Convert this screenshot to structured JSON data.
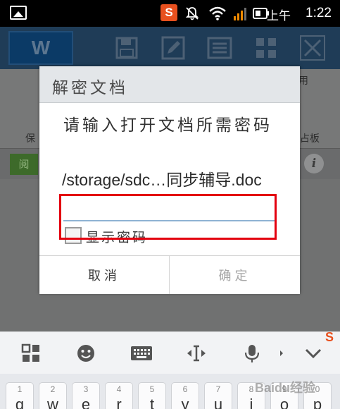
{
  "statusbar": {
    "sogou_label": "S",
    "ampm": "上午",
    "time": "1:22"
  },
  "app": {
    "logo_letter": "W",
    "bg_save_fragment": "保",
    "bg_paste_fragment": "占板",
    "bg_use_fragment": "用",
    "bg_read_fragment": "阅",
    "info_glyph": "i"
  },
  "dialog": {
    "title": "解密文档",
    "message": "请输入打开文档所需密码",
    "file_path": "/storage/sdc…同步辅导.doc",
    "password_value": "",
    "show_password_label": "显示密码",
    "cancel_label": "取消",
    "ok_label": "确定"
  },
  "keyboard": {
    "keys": [
      {
        "num": "1",
        "letter": "q"
      },
      {
        "num": "2",
        "letter": "w"
      },
      {
        "num": "3",
        "letter": "e"
      },
      {
        "num": "4",
        "letter": "r"
      },
      {
        "num": "5",
        "letter": "t"
      },
      {
        "num": "6",
        "letter": "y"
      },
      {
        "num": "7",
        "letter": "u"
      },
      {
        "num": "8",
        "letter": "i"
      },
      {
        "num": "9",
        "letter": "o"
      },
      {
        "num": "0",
        "letter": "p"
      }
    ],
    "watermark": "Baidu经验"
  },
  "colors": {
    "sogou_orange": "#e8501e",
    "highlight_red": "#e3000f",
    "input_underline": "#8fb3d3"
  }
}
